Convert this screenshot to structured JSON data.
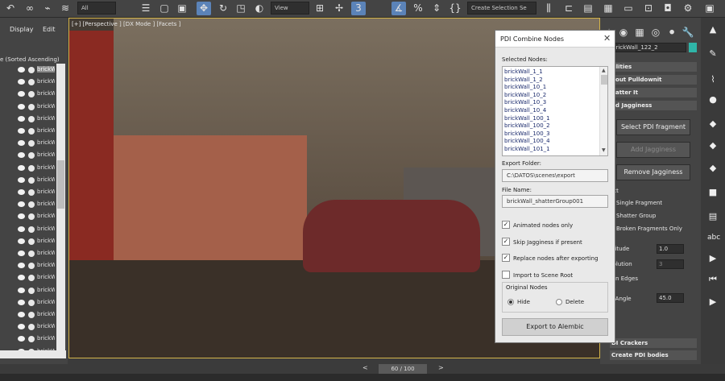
{
  "toolbar": {
    "filter_combo": "All",
    "view_combo": "View",
    "selection_set_combo": "Create Selection Se",
    "snap_number": "3"
  },
  "scene_explorer": {
    "menu_display": "Display",
    "menu_edit": "Edit",
    "sort_label": "e (Sorted Ascending)",
    "rows": [
      "brickW",
      "brickW",
      "brickW",
      "brickW",
      "brickW",
      "brickW",
      "brickW",
      "brickW",
      "brickW",
      "brickW",
      "brickW",
      "brickW",
      "brickW",
      "brickW",
      "brickW",
      "brickW",
      "brickW",
      "brickW",
      "brickW",
      "brickW",
      "brickW",
      "brickW",
      "brickW",
      "brickW"
    ]
  },
  "viewport": {
    "label": "[+] [Perspective ] [DX Mode ] [Facets ]"
  },
  "navigation": {
    "frame_label": "60 / 100",
    "prev_arrow": "<",
    "next_arrow": ">"
  },
  "command_panel": {
    "object_name": "brickWall_122_2",
    "rollouts": {
      "utilities": "tilities",
      "about": "bout Pulldownit",
      "shatter_it": "hatter It",
      "add_jagginess": "dd Jagginess",
      "pdi_crackers": "DI Crackers",
      "create_pdi_bodies": "Create PDI bodies"
    },
    "buttons": {
      "select_pdi_fragment": "Select PDI fragment",
      "add_jagginess": "Add Jagginess",
      "remove_jagginess": "Remove Jagginess"
    },
    "select_label": "ect",
    "radio_options": [
      "Single Fragment",
      "Shatter Group",
      "Broken Fragments Only"
    ],
    "amplitude_label": "plitude",
    "amplitude_value": "1.0",
    "resolution_label": "solution",
    "resolution_value": "3",
    "edges_label": "ten Edges",
    "angle_label": "n Angle",
    "angle_value": "45.0"
  },
  "dialog": {
    "title": "PDI Combine Nodes",
    "close_glyph": "✕",
    "selected_nodes_label": "Selected Nodes:",
    "selected_nodes": [
      "brickWall_1_1",
      "brickWall_1_2",
      "brickWall_10_1",
      "brickWall_10_2",
      "brickWall_10_3",
      "brickWall_10_4",
      "brickWall_100_1",
      "brickWall_100_2",
      "brickWall_100_3",
      "brickWall_100_4",
      "brickWall_101_1"
    ],
    "export_folder_label": "Export Folder:",
    "export_folder_value": "C:\\DATOS\\scenes\\export",
    "file_name_label": "File Name:",
    "file_name_value": "brickWall_shatterGroup001",
    "options": [
      {
        "label": "Animated nodes only",
        "checked": true
      },
      {
        "label": "Skip Jagginess if present",
        "checked": true
      },
      {
        "label": "Replace nodes after exporting",
        "checked": true
      },
      {
        "label": "Import to Scene Root",
        "checked": false
      }
    ],
    "original_nodes_label": "Original Nodes",
    "hide_label": "Hide",
    "delete_label": "Delete",
    "original_nodes_selected": "Hide",
    "export_button": "Export to Alembic"
  },
  "colors": {
    "accent": "#5b83b8",
    "viewport_border": "#d4b44a"
  }
}
